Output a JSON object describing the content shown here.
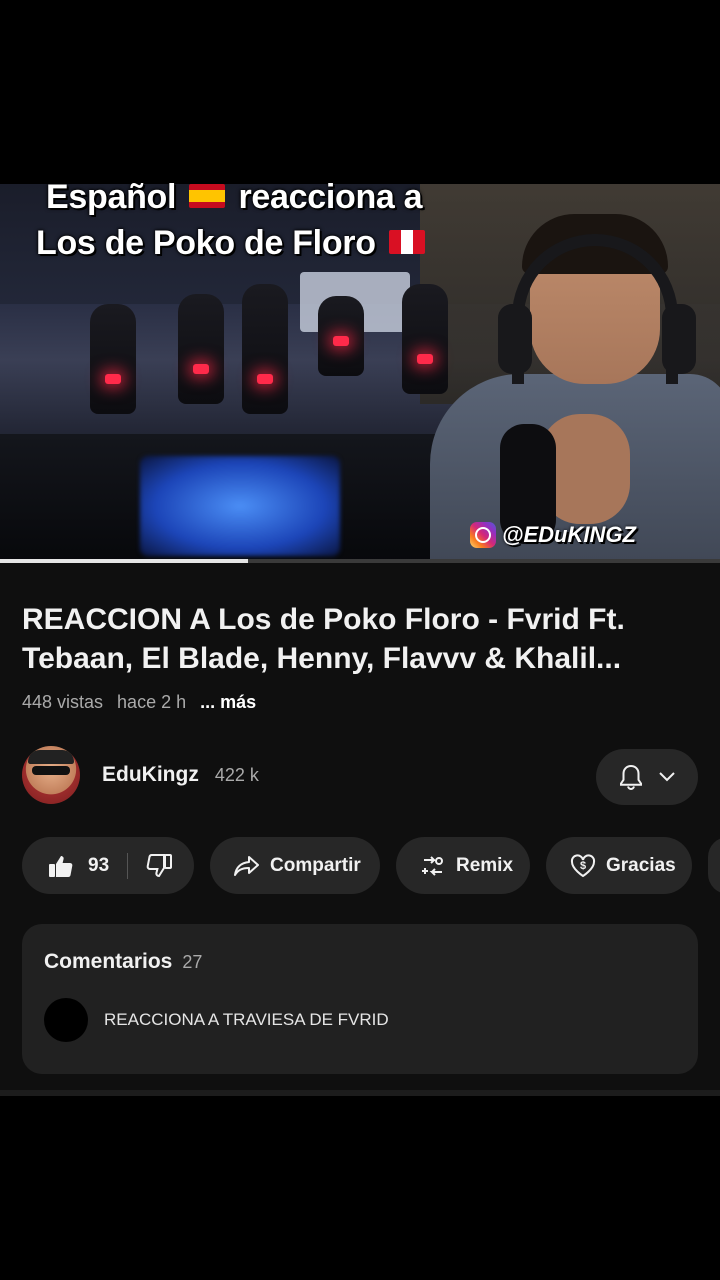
{
  "video": {
    "overlay_line1_before": "Español",
    "overlay_line1_after": "reacciona a",
    "overlay_line2": "Los de Poko de Floro",
    "flag_line1": "flag-spain-icon",
    "flag_line2": "flag-peru-icon",
    "instagram_handle": "@EDuKINGZ",
    "progress_fraction": 0.345
  },
  "details": {
    "title": "REACCION A Los de Poko Floro - Fvrid Ft. Tebaan, El Blade, Henny, Flavvv & Khalil...",
    "views": "448 vistas",
    "age": "hace 2 h",
    "more_label": "... más"
  },
  "channel": {
    "name": "EduKingz",
    "subscribers": "422 k"
  },
  "actions": {
    "likes": "93",
    "share_label": "Compartir",
    "remix_label": "Remix",
    "thanks_label": "Gracias"
  },
  "comments": {
    "label": "Comentarios",
    "count": "27",
    "top_comment": "REACCIONA A TRAVIESA DE FVRID"
  },
  "colors": {
    "background": "#000000",
    "panel": "#0f0f0f",
    "pill": "#272727",
    "comments_box": "#212121"
  }
}
